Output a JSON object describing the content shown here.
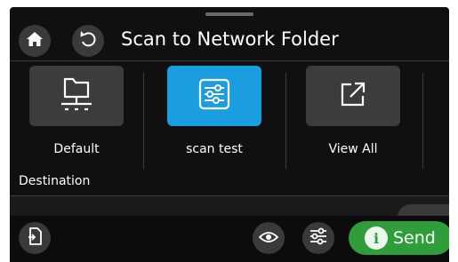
{
  "header": {
    "title": "Scan to Network Folder",
    "home_icon": "home-icon",
    "back_icon": "back-icon"
  },
  "tiles": [
    {
      "label": "Default",
      "icon": "network-folder-icon",
      "selected": false
    },
    {
      "label": "scan test",
      "icon": "settings-sliders-icon",
      "selected": true
    },
    {
      "label": "View All",
      "icon": "open-external-icon",
      "selected": false
    }
  ],
  "destination": {
    "label": "Destination"
  },
  "bottom_bar": {
    "send_label": "Send",
    "send_info_glyph": "i"
  },
  "colors": {
    "background": "#101010",
    "selected_tile": "#1a9ee0",
    "send_button": "#2f9e3a",
    "button": "#3a3a3a"
  }
}
